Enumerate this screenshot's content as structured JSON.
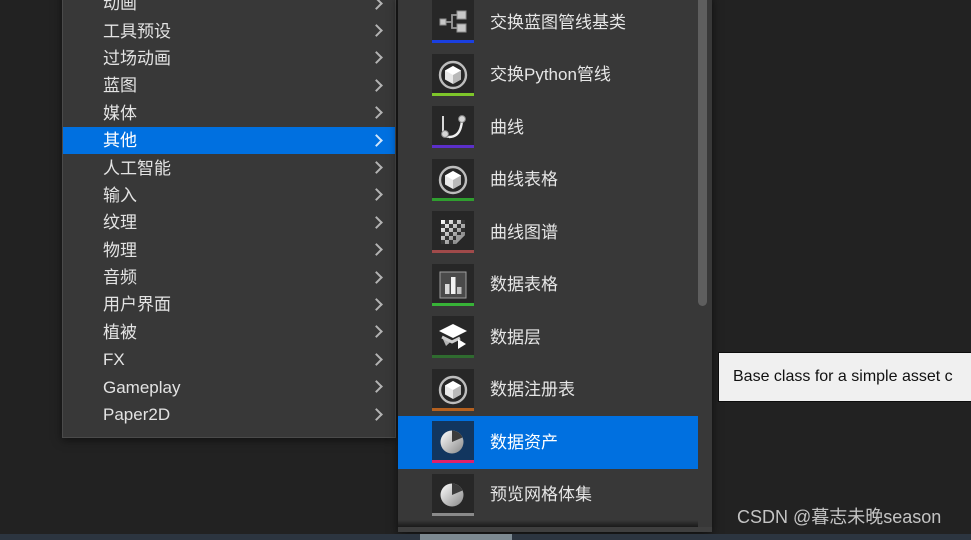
{
  "app": {
    "theme": "unreal-engine-dark-editor",
    "background_color": "#222222",
    "accent_color": "#0070e0",
    "panel_color": "#383838"
  },
  "category_menu": {
    "name": "asset-category-menu",
    "items": [
      {
        "label": "动画",
        "has_submenu": true,
        "selected": false,
        "clipped": true
      },
      {
        "label": "工具预设",
        "has_submenu": true,
        "selected": false
      },
      {
        "label": "过场动画",
        "has_submenu": true,
        "selected": false
      },
      {
        "label": "蓝图",
        "has_submenu": true,
        "selected": false
      },
      {
        "label": "媒体",
        "has_submenu": true,
        "selected": false
      },
      {
        "label": "其他",
        "has_submenu": true,
        "selected": true
      },
      {
        "label": "人工智能",
        "has_submenu": true,
        "selected": false
      },
      {
        "label": "输入",
        "has_submenu": true,
        "selected": false
      },
      {
        "label": "纹理",
        "has_submenu": true,
        "selected": false
      },
      {
        "label": "物理",
        "has_submenu": true,
        "selected": false
      },
      {
        "label": "音频",
        "has_submenu": true,
        "selected": false
      },
      {
        "label": "用户界面",
        "has_submenu": true,
        "selected": false
      },
      {
        "label": "植被",
        "has_submenu": true,
        "selected": false
      },
      {
        "label": "FX",
        "has_submenu": true,
        "selected": false
      },
      {
        "label": "Gameplay",
        "has_submenu": true,
        "selected": false
      },
      {
        "label": "Paper2D",
        "has_submenu": true,
        "selected": false
      }
    ]
  },
  "asset_menu": {
    "name": "other-assets-submenu",
    "scroll_position": "top",
    "items": [
      {
        "label": "交换蓝图管线基类",
        "icon": "blueprint-node-graph-icon",
        "bar_color": "#1a3fe0",
        "selected": false
      },
      {
        "label": "交换Python管线",
        "icon": "cube-in-circle-icon",
        "bar_color": "#7ec62a",
        "selected": false
      },
      {
        "label": "曲线",
        "icon": "curve-handle-icon",
        "bar_color": "#5b2fc9",
        "selected": false
      },
      {
        "label": "曲线表格",
        "icon": "cube-in-circle-icon",
        "bar_color": "#2f9e2f",
        "selected": false
      },
      {
        "label": "曲线图谱",
        "icon": "checker-gradient-icon",
        "bar_color": "#a04a4a",
        "selected": false
      },
      {
        "label": "数据表格",
        "icon": "bar-chart-icon",
        "bar_color": "#37b337",
        "selected": false
      },
      {
        "label": "数据层",
        "icon": "layers-play-icon",
        "bar_color": "#2f6b2f",
        "selected": false
      },
      {
        "label": "数据注册表",
        "icon": "cube-in-circle-icon",
        "bar_color": "#b4601f",
        "selected": false
      },
      {
        "label": "数据资产",
        "icon": "pie-chart-icon",
        "bar_color": "#e0206a",
        "selected": true
      },
      {
        "label": "预览网格体集",
        "icon": "pie-chart-icon",
        "bar_color": "#8a8a8a",
        "selected": false
      }
    ]
  },
  "tooltip": {
    "name": "asset-description-tooltip",
    "text": "Base class for a simple asset c"
  },
  "watermark": {
    "text": "CSDN @暮志未晚season"
  }
}
